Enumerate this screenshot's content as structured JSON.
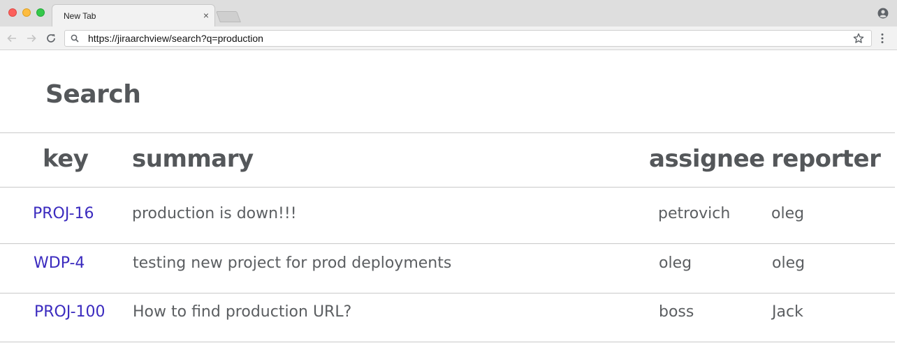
{
  "browser": {
    "tab_title": "New Tab",
    "tab_close": "×",
    "url": "https://jiraarchview/search?q=production"
  },
  "page": {
    "title": "Search"
  },
  "table": {
    "columns": [
      "key",
      "summary",
      "assignee",
      "reporter"
    ],
    "rows": [
      {
        "key": "PROJ-16",
        "summary": "production is down!!!",
        "assignee": "petrovich",
        "reporter": "oleg"
      },
      {
        "key": "WDP-4",
        "summary": "testing new project for prod deployments",
        "assignee": "oleg",
        "reporter": "oleg"
      },
      {
        "key": "PROJ-100",
        "summary": "How to find production URL?",
        "assignee": "boss",
        "reporter": "Jack"
      }
    ]
  },
  "colors": {
    "link": "#3b2bbf",
    "heading": "#54575a",
    "text": "#5b5e61",
    "divider": "#c9c9c9"
  }
}
